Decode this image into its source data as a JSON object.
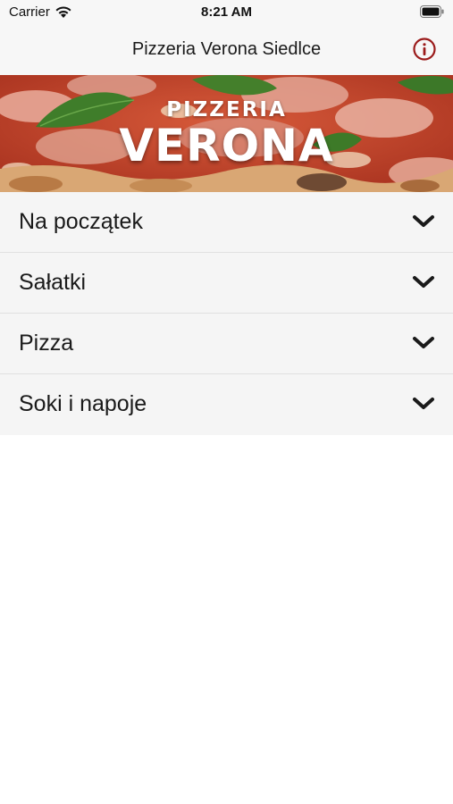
{
  "status_bar": {
    "carrier": "Carrier",
    "time": "8:21 AM",
    "wifi_icon": "wifi-icon",
    "battery_icon": "battery-icon"
  },
  "nav": {
    "title": "Pizzeria Verona Siedlce",
    "info_icon": "info-icon",
    "accent_color": "#9b1b1b"
  },
  "banner": {
    "line1": "PIZZERIA",
    "line2": "VERONA"
  },
  "menu": {
    "items": [
      {
        "label": "Na początek",
        "icon": "chevron-down-icon"
      },
      {
        "label": "Sałatki",
        "icon": "chevron-down-icon"
      },
      {
        "label": "Pizza",
        "icon": "chevron-down-icon"
      },
      {
        "label": "Soki i napoje",
        "icon": "chevron-down-icon"
      }
    ]
  }
}
